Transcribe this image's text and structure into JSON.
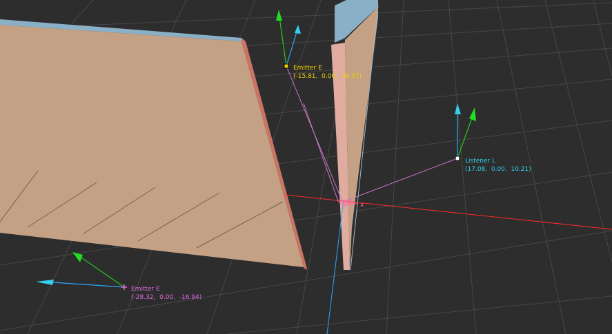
{
  "scene": {
    "background": "#2d2d2d",
    "grid_color": "#474747",
    "x_axis_color": "#ff2a2a",
    "y_axis_color": "#2aa8ff",
    "connection_color": "#c877c8",
    "wall_face_color": "#c4a185",
    "wall_side_color": "#c97464",
    "wall_top_color": "#8ab0c8"
  },
  "emitters": [
    {
      "name": "Emitter E",
      "coords": "(-15.81,  0.00,  26.37)",
      "color": "#f0d000",
      "marker": "square-marker"
    },
    {
      "name": "Emitter E",
      "coords": "(-28.32,  0.00,  -16.94)",
      "color": "#e06ae0",
      "marker": "cross-marker"
    }
  ],
  "listener": {
    "name": "Listener L",
    "coords": "(17.08,  0.00,  10.21)",
    "color": "#35d0f0",
    "marker": "square-marker"
  },
  "origin_label": "x"
}
